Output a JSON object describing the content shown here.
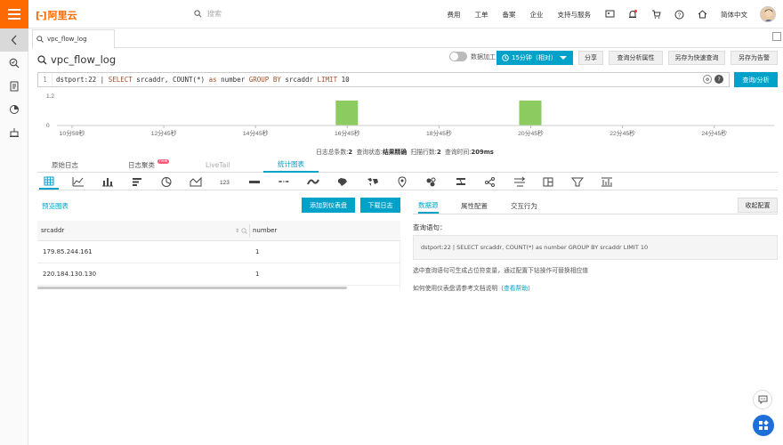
{
  "topbar": {
    "brand": "阿里云",
    "search_placeholder": "搜索",
    "nav": [
      "费用",
      "工单",
      "备案",
      "企业",
      "支持与服务"
    ],
    "lang": "简体中文"
  },
  "tab": {
    "label": "vpc_flow_log"
  },
  "page_title": "vpc_flow_log",
  "toolbar": {
    "toggle_label": "数据加工",
    "time_label": "15分钟（相对）",
    "share": "分享",
    "query_attr": "查询分析属性",
    "save_search": "另存为快速查询",
    "save_alert": "另存为告警"
  },
  "query": {
    "line": "1",
    "text_a": "dstport:22 | ",
    "kw1": "SELECT",
    "text_b": " srcaddr, COUNT(*) ",
    "kw2": "as",
    "text_c": " number ",
    "kw3": "GROUP BY",
    "text_d": " srcaddr ",
    "kw4": "LIMIT",
    "text_e": " 10",
    "button": "查询/分析"
  },
  "histogram": {
    "y_labels": [
      "1.2",
      "0"
    ],
    "x_labels": [
      "10分59秒",
      "12分45秒",
      "14分45秒",
      "16分45秒",
      "18分45秒",
      "20分45秒",
      "22分45秒",
      "24分45秒"
    ],
    "bar_color": "#8bcb5f"
  },
  "chart_data": {
    "type": "bar",
    "categories": [
      "16分45秒",
      "20分45秒"
    ],
    "values": [
      1,
      1
    ],
    "ylim": [
      0,
      1.2
    ]
  },
  "stats": {
    "total_label": "日志总条数:",
    "total": "2",
    "status_label": "查询状态:",
    "status": "结果精确",
    "scanned_label": "扫描行数:",
    "scanned": "2",
    "time_label": "查询时间:",
    "time": "209ms"
  },
  "log_tabs": {
    "raw": "原始日志",
    "cluster": "日志聚类",
    "new_badge": "new",
    "livetail": "LiveTail",
    "stats": "统计图表"
  },
  "chart_types": [
    "table",
    "line",
    "bar",
    "horizontal-bar",
    "pie",
    "area",
    "number",
    "progress",
    "map",
    "flow",
    "china-map",
    "world-map",
    "amap",
    "word-cloud",
    "sankey",
    "treemap",
    "tree",
    "funnel",
    "time-series",
    "trend"
  ],
  "preview": "预览图表",
  "actions": {
    "add_dashboard": "添加到仪表盘",
    "download": "下载日志"
  },
  "table": {
    "headers": [
      "srcaddr",
      "number"
    ],
    "rows": [
      [
        "179.85.244.161",
        "1"
      ],
      [
        "220.184.130.130",
        "1"
      ]
    ]
  },
  "right": {
    "tabs": [
      "数据源",
      "属性配置",
      "交互行为"
    ],
    "collapse": "收起配置",
    "query_label": "查询语句：",
    "sql": "dstport:22 | SELECT srcaddr, COUNT(*) as number GROUP BY srcaddr LIMIT 10",
    "hint1": "选中查询语句可生成占位符变量，通过配置下钻操作可替换相应值",
    "hint2_prefix": "如何使用仪表盘请参考文档说明（",
    "hint2_link": "查看帮助",
    "hint2_suffix": "）"
  },
  "colors": {
    "accent": "#00a2ca",
    "brand": "#ff6a00"
  }
}
